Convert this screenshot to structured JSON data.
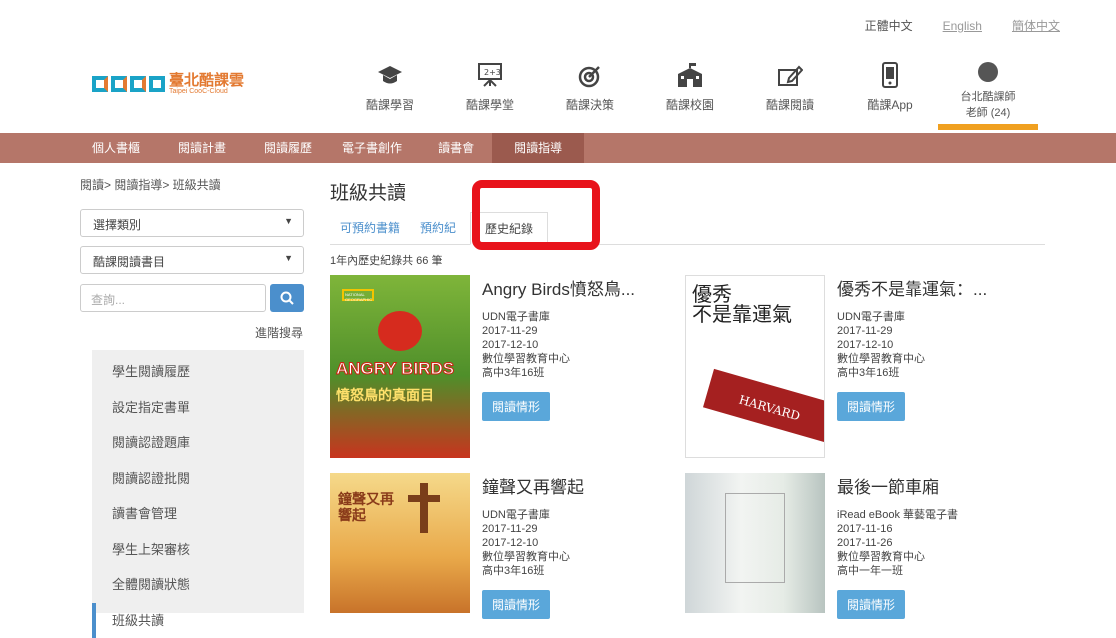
{
  "lang": {
    "current": "正體中文",
    "en": "English",
    "sc": "簡体中文"
  },
  "logo": {
    "title": "臺北酷課雲",
    "subtitle": "Taipei CooC-Cloud"
  },
  "topnav": [
    {
      "label": "酷課學習",
      "icon": "graduation-cap-icon"
    },
    {
      "label": "酷課學堂",
      "icon": "blackboard-icon"
    },
    {
      "label": "酷課決策",
      "icon": "target-icon"
    },
    {
      "label": "酷課校園",
      "icon": "school-building-icon"
    },
    {
      "label": "酷課閱讀",
      "icon": "reading-edit-icon"
    },
    {
      "label": "酷課App",
      "icon": "mobile-phone-icon"
    }
  ],
  "user": {
    "line1": "台北酷課師",
    "line2": "老師 (24)"
  },
  "mainnav": [
    "個人書櫃",
    "閱讀計畫",
    "閱讀履歷",
    "電子書創作",
    "讀書會",
    "閱讀指導"
  ],
  "breadcrumb": "閱讀> 閱讀指導> 班級共讀",
  "filters": {
    "category": "選擇類別",
    "booklist": "酷課閱讀書目",
    "search_placeholder": "查詢...",
    "advanced": "進階搜尋"
  },
  "side": [
    "學生閱讀履歷",
    "設定指定書單",
    "閱讀認證題庫",
    "閱讀認證批閱",
    "讀書會管理",
    "學生上架審核",
    "全體閱讀狀態",
    "班級共讀"
  ],
  "page_title": "班級共讀",
  "tabs": [
    "可預約書籍",
    "預約紀",
    "歷史紀錄"
  ],
  "count_text": "1年內歷史紀錄共 66 筆",
  "books": [
    {
      "title": "Angry Birds憤怒鳥...",
      "publisher": "UDN電子書庫",
      "d1": "2017-11-29",
      "d2": "2017-12-10",
      "org": "數位學習教育中心",
      "cls": "高中3年16班",
      "btn": "閱讀情形",
      "cover_a": "ANGRY BIRDS",
      "cover_b": "憤怒鳥的真面目",
      "cover_c": "NATIONAL GEOGRAPHIC"
    },
    {
      "title": "優秀不是靠運氣：...",
      "publisher": "UDN電子書庫",
      "d1": "2017-11-29",
      "d2": "2017-12-10",
      "org": "數位學習教育中心",
      "cls": "高中3年16班",
      "btn": "閱讀情形",
      "cover_a": "優秀",
      "cover_b": "不是靠運氣",
      "cover_c": "HARVARD"
    },
    {
      "title": "鐘聲又再響起",
      "publisher": "UDN電子書庫",
      "d1": "2017-11-29",
      "d2": "2017-12-10",
      "org": "數位學習教育中心",
      "cls": "高中3年16班",
      "btn": "閱讀情形",
      "cover_a": "鐘聲又再響起",
      "cover_b": "",
      "cover_c": ""
    },
    {
      "title": "最後一節車廂",
      "publisher": "iRead eBook 華藝電子書",
      "d1": "2017-11-16",
      "d2": "2017-11-26",
      "org": "數位學習教育中心",
      "cls": "高中一年一班",
      "btn": "閱讀情形",
      "cover_a": "",
      "cover_b": "",
      "cover_c": ""
    }
  ]
}
